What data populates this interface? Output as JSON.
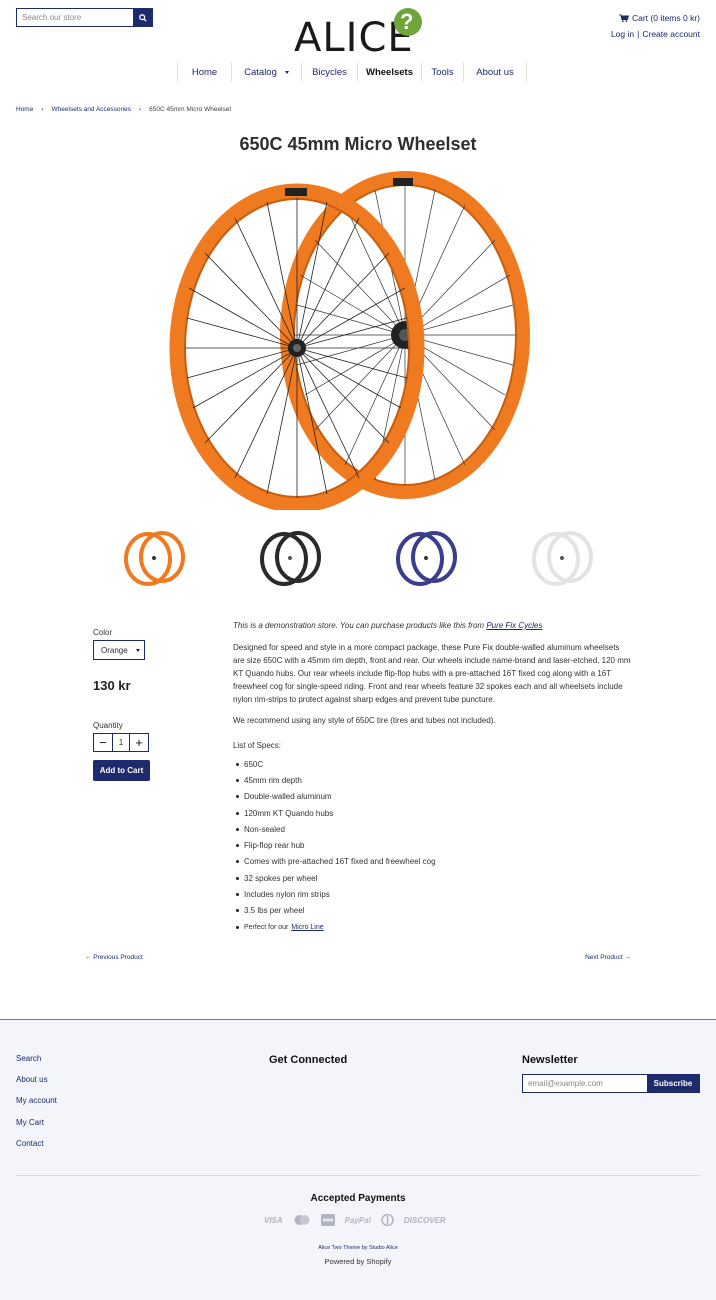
{
  "header": {
    "search_placeholder": "Search our store",
    "logo_text": "ALICE",
    "logo_mark": "?",
    "cart_label": "Cart (0 items 0 kr)",
    "login": "Log in",
    "separator": "|",
    "create_account": "Create account"
  },
  "nav": [
    {
      "label": "Home"
    },
    {
      "label": "Catalog"
    },
    {
      "label": "Bicycles"
    },
    {
      "label": "Wheelsets"
    },
    {
      "label": "Tools"
    },
    {
      "label": "About us"
    }
  ],
  "breadcrumb": {
    "home": "Home",
    "category": "Wheelsets and Accessories",
    "current": "650C 45mm Micro Wheelset",
    "sep": "›"
  },
  "product": {
    "title": "650C 45mm Micro Wheelset",
    "thumbnails": [
      "orange",
      "black",
      "navy",
      "white"
    ],
    "color_label": "Color",
    "color_value": "Orange",
    "price": "130 kr",
    "quantity_label": "Quantity",
    "quantity_value": "1",
    "add_to_cart": "Add to Cart",
    "colors": {
      "orange": "#f07a1f",
      "black": "#2a2a2a",
      "navy": "#3b3e8c",
      "white": "#e9e9e9",
      "accent": "#1d2a6b"
    }
  },
  "description": {
    "demo_text": "This is a demonstration store. You can purchase products like this from",
    "demo_link": "Pure Fix Cycles",
    "paragraph1": "Designed for speed and style in a more compact package, these Pure Fix double-walled aluminum wheelsets are size 650C with a 45mm rim depth, front and rear. Our wheels include name-brand and laser-etched, 120 mm KT Quando hubs. Our rear wheels include flip-flop hubs with a pre-attached 16T fixed cog along with a 16T freewheel cog for single-speed riding. Front and rear wheels feature 32 spokes each and all wheelsets include nylon rim-strips to protect against sharp edges and prevent tube puncture.",
    "paragraph2": "We recommend using any style of 650C tire (tires and tubes not included).",
    "specs_heading": "List of Specs:",
    "specs": [
      "650C",
      "45mm rim depth",
      "Double-walled aluminum",
      "120mm KT Quando hubs",
      "Non-sealed",
      "Flip-flop rear hub",
      "Comes with pre-attached 16T fixed and freewheel cog",
      "32 spokes per wheel",
      "Includes nylon rim strips",
      "3.5 lbs per wheel"
    ],
    "last_spec_text": "Perfect for our",
    "last_spec_link": "Micro Line"
  },
  "product_nav": {
    "previous": "← Previous Product",
    "next": "Next Product →"
  },
  "footer": {
    "links": [
      "Search",
      "About us",
      "My account",
      "My Cart",
      "Contact"
    ],
    "connected_heading": "Get Connected",
    "newsletter_heading": "Newsletter",
    "email_placeholder": "email@example.com",
    "subscribe": "Subscribe",
    "payments_heading": "Accepted Payments",
    "payments": [
      "VISA",
      "PayPal",
      "DISCOVER"
    ],
    "theme_credit": "Alice Two Theme by Studio Alice",
    "powered_by": "Powered by Shopify"
  }
}
